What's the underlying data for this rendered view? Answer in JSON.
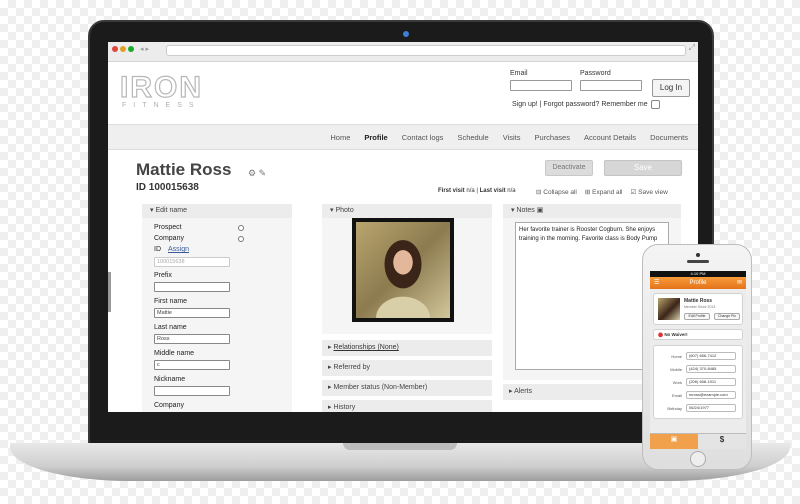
{
  "browser": {
    "back_forward": "◂ ▸",
    "expand_glyph": "⤢"
  },
  "logo": {
    "main": "IRON",
    "sub": "FITNESS"
  },
  "login": {
    "email_label": "Email",
    "password_label": "Password",
    "button": "Log In",
    "links": "Sign up! | Forgot password?  Remember me"
  },
  "nav": {
    "tabs": [
      "Home",
      "Profile",
      "Contact logs",
      "Schedule",
      "Visits",
      "Purchases",
      "Account Details",
      "Documents"
    ],
    "active": "Profile"
  },
  "profile": {
    "name": "Mattie Ross",
    "id": "ID 100015638",
    "visits": {
      "first_label": "First visit",
      "first_value": "n/a",
      "sep": "|",
      "last_label": "Last visit",
      "last_value": "n/a"
    },
    "deactivate": "Deactivate",
    "save": "Save",
    "collapse_all": "Collapse all",
    "expand_all": "Expand all",
    "save_view": "Save view"
  },
  "edit_name": {
    "header": "Edit name",
    "prospect": "Prospect",
    "company_type": "Company",
    "id_label": "ID",
    "assign": "Assign",
    "id_value": "100015638",
    "prefix_label": "Prefix",
    "prefix_value": "",
    "first_name_label": "First name",
    "first_name_value": "Mattie",
    "last_name_label": "Last name",
    "last_name_value": "Ross",
    "middle_name_label": "Middle name",
    "middle_name_value": "c",
    "nickname_label": "Nickname",
    "nickname_value": "",
    "company_label": "Company"
  },
  "photo_panel": {
    "header": "Photo"
  },
  "accordions": {
    "relationships": "Relationships (None)",
    "referred_by": "Referred by",
    "member_status": "Member status (Non-Member)",
    "history": "History"
  },
  "notes": {
    "header": "Notes",
    "text": "Her favorite trainer is Rooster Cogburn. She enjoys training in the morning. Favorite class is Body Pump"
  },
  "alerts": {
    "header": "Alerts"
  },
  "phone": {
    "status": "4:10 PM",
    "title": "Profile",
    "name": "Mattie Ross",
    "since": "Member Since 2013",
    "edit_btn": "Edit Profile",
    "change_btn": "Change Pic",
    "waiver": "No Waiver!",
    "contacts": [
      {
        "k": "Home",
        "v": "(607) 656-7412"
      },
      {
        "k": "Mobile",
        "v": "(424) 370-8485"
      },
      {
        "k": "Work",
        "v": "(206) 658-1911"
      },
      {
        "k": "Email",
        "v": "mross@example.com"
      },
      {
        "k": "Birthday",
        "v": "06/24/1977"
      }
    ],
    "tab_dollar": "$"
  },
  "colors": {
    "accent_orange": "#e4731a",
    "brand_gray": "#b7b7b7",
    "link_blue": "#3a5a9c"
  }
}
